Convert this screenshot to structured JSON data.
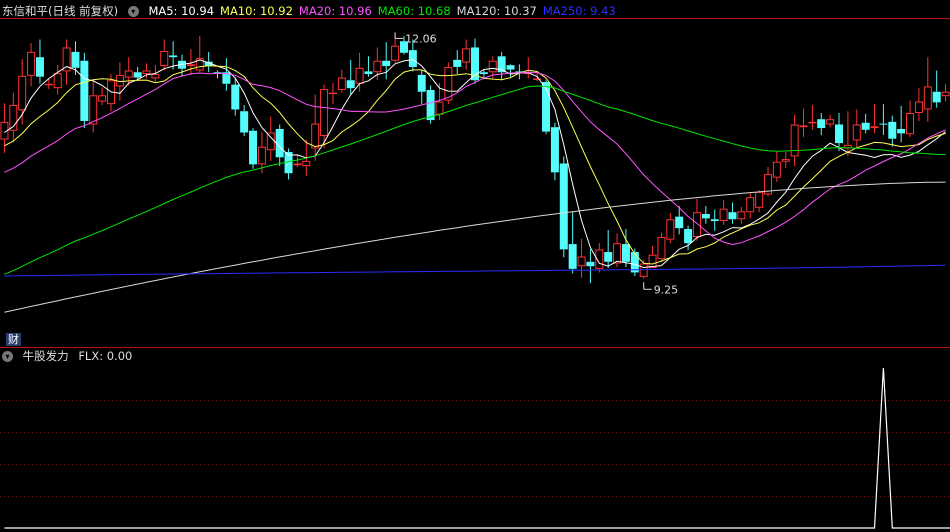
{
  "colors": {
    "background": "#000000",
    "up": "#ff3232",
    "down": "#54fcfc",
    "grid": "#7a0d0d",
    "separator": "#c01010",
    "ma5": "#ffffff",
    "ma10": "#ffff54",
    "ma20": "#ff54ff",
    "ma60": "#00e600",
    "ma120": "#d8d8d8",
    "ma250": "#2c2cff",
    "flx": "#ffffff"
  },
  "header": {
    "title": "东信和平(日线 前复权)",
    "dropdown_icon": "chevron-down-icon",
    "ma_labels": [
      {
        "text": "MA5: 10.94",
        "color": "#ffffff"
      },
      {
        "text": "MA10: 10.92",
        "color": "#ffff54"
      },
      {
        "text": "MA20: 10.96",
        "color": "#ff54ff"
      },
      {
        "text": "MA60: 10.68",
        "color": "#00e600"
      },
      {
        "text": "MA120: 10.37",
        "color": "#d8d8d8"
      },
      {
        "text": "MA250: 9.43",
        "color": "#2c2cff"
      }
    ]
  },
  "cai_label": "财",
  "indicator": {
    "title": "牛股发力",
    "value_label": "FLX: 0.00",
    "dropdown_icon": "chevron-down-icon"
  },
  "chart_data": [
    {
      "type": "candlestick",
      "price_range": [
        8.7,
        12.2
      ],
      "annotations": [
        {
          "text": "12.06",
          "candle_index": 44,
          "value": 12.06
        },
        {
          "text": "9.25",
          "candle_index": 72,
          "value": 9.25
        }
      ],
      "candles": [
        [
          10.85,
          11.05,
          11.26,
          10.7
        ],
        [
          10.95,
          11.24,
          11.38,
          10.82
        ],
        [
          11.18,
          11.57,
          11.76,
          11.02
        ],
        [
          11.57,
          11.84,
          11.94,
          11.45
        ],
        [
          11.78,
          11.56,
          11.98,
          11.48
        ],
        [
          11.48,
          11.48,
          11.54,
          11.42
        ],
        [
          11.43,
          11.6,
          11.69,
          11.36
        ],
        [
          11.62,
          11.89,
          11.98,
          11.47
        ],
        [
          11.84,
          11.66,
          11.96,
          11.58
        ],
        [
          11.74,
          11.06,
          11.83,
          10.98
        ],
        [
          11.02,
          11.35,
          11.53,
          10.93
        ],
        [
          11.28,
          11.35,
          11.44,
          11.24
        ],
        [
          11.25,
          11.52,
          11.59,
          11.17
        ],
        [
          11.45,
          11.58,
          11.72,
          11.29
        ],
        [
          11.55,
          11.63,
          11.78,
          11.46
        ],
        [
          11.61,
          11.55,
          11.67,
          11.51
        ],
        [
          11.59,
          11.63,
          11.71,
          11.54
        ],
        [
          11.54,
          11.59,
          11.69,
          11.5
        ],
        [
          11.68,
          11.85,
          11.98,
          11.63
        ],
        [
          11.8,
          11.78,
          11.96,
          11.64
        ],
        [
          11.74,
          11.65,
          11.81,
          11.56
        ],
        [
          11.68,
          11.7,
          11.87,
          11.58
        ],
        [
          11.63,
          11.77,
          12.02,
          11.61
        ],
        [
          11.73,
          11.68,
          11.84,
          11.61
        ],
        [
          11.61,
          11.6,
          11.63,
          11.54
        ],
        [
          11.61,
          11.48,
          11.77,
          11.4
        ],
        [
          11.47,
          11.19,
          11.55,
          11.12
        ],
        [
          11.17,
          10.93,
          11.24,
          10.89
        ],
        [
          10.95,
          10.57,
          10.98,
          10.52
        ],
        [
          10.57,
          10.77,
          10.93,
          10.47
        ],
        [
          10.73,
          10.93,
          11.11,
          10.61
        ],
        [
          10.97,
          10.65,
          11.02,
          10.55
        ],
        [
          10.71,
          10.47,
          10.75,
          10.4
        ],
        [
          10.56,
          10.58,
          10.68,
          10.54
        ],
        [
          10.55,
          10.61,
          10.85,
          10.44
        ],
        [
          10.75,
          11.03,
          11.36,
          10.61
        ],
        [
          10.89,
          11.42,
          11.47,
          10.75
        ],
        [
          11.38,
          11.38,
          11.49,
          11.25
        ],
        [
          11.41,
          11.55,
          11.64,
          11.38
        ],
        [
          11.52,
          11.43,
          11.75,
          11.36
        ],
        [
          11.48,
          11.66,
          11.83,
          11.39
        ],
        [
          11.62,
          11.59,
          11.79,
          11.56
        ],
        [
          11.61,
          11.74,
          11.89,
          11.52
        ],
        [
          11.74,
          11.68,
          11.95,
          11.53
        ],
        [
          11.74,
          11.91,
          12.06,
          11.72
        ],
        [
          11.96,
          11.83,
          12.02,
          11.81
        ],
        [
          11.86,
          11.67,
          11.98,
          11.62
        ],
        [
          11.58,
          11.39,
          11.64,
          11.25
        ],
        [
          11.41,
          11.07,
          11.46,
          11.03
        ],
        [
          11.13,
          11.28,
          11.49,
          11.07
        ],
        [
          11.29,
          11.67,
          11.72,
          11.25
        ],
        [
          11.75,
          11.67,
          11.86,
          11.59
        ],
        [
          11.72,
          11.88,
          11.98,
          11.64
        ],
        [
          11.89,
          11.52,
          11.99,
          11.48
        ],
        [
          11.61,
          11.59,
          11.64,
          11.53
        ],
        [
          11.61,
          11.74,
          11.79,
          11.54
        ],
        [
          11.79,
          11.61,
          11.84,
          11.52
        ],
        [
          11.69,
          11.64,
          11.7,
          11.56
        ],
        [
          11.62,
          11.6,
          11.7,
          11.53
        ],
        [
          11.59,
          11.61,
          11.78,
          11.54
        ],
        [
          11.54,
          11.54,
          11.62,
          11.51
        ],
        [
          11.5,
          10.94,
          11.52,
          10.91
        ],
        [
          10.99,
          10.48,
          11.04,
          10.39
        ],
        [
          10.58,
          9.61,
          10.66,
          9.52
        ],
        [
          9.67,
          9.39,
          10.04,
          9.34
        ],
        [
          9.42,
          9.53,
          9.73,
          9.29
        ],
        [
          9.47,
          9.42,
          9.61,
          9.23
        ],
        [
          9.39,
          9.61,
          9.68,
          9.35
        ],
        [
          9.58,
          9.47,
          9.83,
          9.4
        ],
        [
          9.45,
          9.68,
          9.79,
          9.41
        ],
        [
          9.67,
          9.47,
          9.84,
          9.41
        ],
        [
          9.58,
          9.35,
          9.62,
          9.31
        ],
        [
          9.3,
          9.45,
          9.49,
          9.28
        ],
        [
          9.4,
          9.55,
          9.65,
          9.4
        ],
        [
          9.5,
          9.75,
          9.8,
          9.48
        ],
        [
          9.72,
          9.95,
          10.02,
          9.68
        ],
        [
          9.98,
          9.85,
          10.1,
          9.78
        ],
        [
          9.84,
          9.68,
          9.88,
          9.6
        ],
        [
          9.75,
          10.03,
          10.18,
          9.71
        ],
        [
          10.01,
          9.96,
          10.1,
          9.9
        ],
        [
          9.95,
          9.93,
          10.06,
          9.82
        ],
        [
          9.93,
          10.07,
          10.17,
          9.89
        ],
        [
          10.03,
          9.95,
          10.14,
          9.9
        ],
        [
          9.95,
          10.04,
          10.09,
          9.9
        ],
        [
          10.03,
          10.2,
          10.26,
          9.96
        ],
        [
          10.08,
          10.26,
          10.28,
          10.03
        ],
        [
          10.23,
          10.46,
          10.54,
          10.21
        ],
        [
          10.42,
          10.6,
          10.71,
          10.37
        ],
        [
          10.6,
          10.63,
          10.71,
          10.53
        ],
        [
          10.66,
          11.02,
          11.13,
          10.55
        ],
        [
          10.99,
          11.01,
          11.2,
          10.88
        ],
        [
          11.05,
          11.05,
          11.24,
          10.96
        ],
        [
          11.08,
          10.98,
          11.15,
          10.9
        ],
        [
          11.02,
          11.08,
          11.13,
          10.99
        ],
        [
          11.02,
          10.81,
          11.15,
          10.72
        ],
        [
          10.75,
          10.79,
          11.17,
          10.66
        ],
        [
          10.84,
          11.02,
          11.19,
          10.76
        ],
        [
          11.04,
          10.96,
          11.14,
          10.92
        ],
        [
          10.98,
          11.0,
          11.25,
          10.92
        ],
        [
          11.03,
          11.02,
          11.25,
          10.9
        ],
        [
          11.05,
          10.86,
          11.12,
          10.77
        ],
        [
          10.97,
          10.92,
          11.23,
          10.82
        ],
        [
          10.91,
          11.15,
          11.29,
          10.88
        ],
        [
          11.15,
          11.28,
          11.43,
          11.06
        ],
        [
          11.19,
          11.45,
          11.78,
          11.05
        ],
        [
          11.39,
          11.27,
          11.63,
          11.21
        ],
        [
          11.34,
          11.39,
          11.48,
          11.28
        ]
      ],
      "moving_averages": {
        "MA5": 10.94,
        "MA10": 10.92,
        "MA20": 10.96,
        "MA60": 10.68,
        "MA120": 10.37,
        "MA250": 9.43
      }
    },
    {
      "type": "line",
      "series": [
        {
          "name": "FLX",
          "values": [
            0,
            0,
            0,
            0,
            0,
            0,
            0,
            0,
            0,
            0,
            0,
            0,
            0,
            0,
            0,
            0,
            0,
            0,
            0,
            0,
            0,
            0,
            0,
            0,
            0,
            0,
            0,
            0,
            0,
            0,
            0,
            0,
            0,
            0,
            0,
            0,
            0,
            0,
            0,
            0,
            0,
            0,
            0,
            0,
            0,
            0,
            0,
            0,
            0,
            0,
            0,
            0,
            0,
            0,
            0,
            0,
            0,
            0,
            0,
            0,
            0,
            0,
            0,
            0,
            0,
            0,
            0,
            0,
            0,
            0,
            0,
            0,
            0,
            0,
            0,
            0,
            0,
            0,
            0,
            0,
            0,
            0,
            0,
            0,
            0,
            0,
            0,
            0,
            0,
            0,
            0,
            0,
            0,
            0,
            0,
            0,
            0,
            0,
            0,
            1,
            0,
            0,
            0,
            0,
            0,
            0,
            0,
            0,
            0,
            0,
            0
          ]
        }
      ],
      "ylim": [
        0,
        1
      ]
    }
  ]
}
